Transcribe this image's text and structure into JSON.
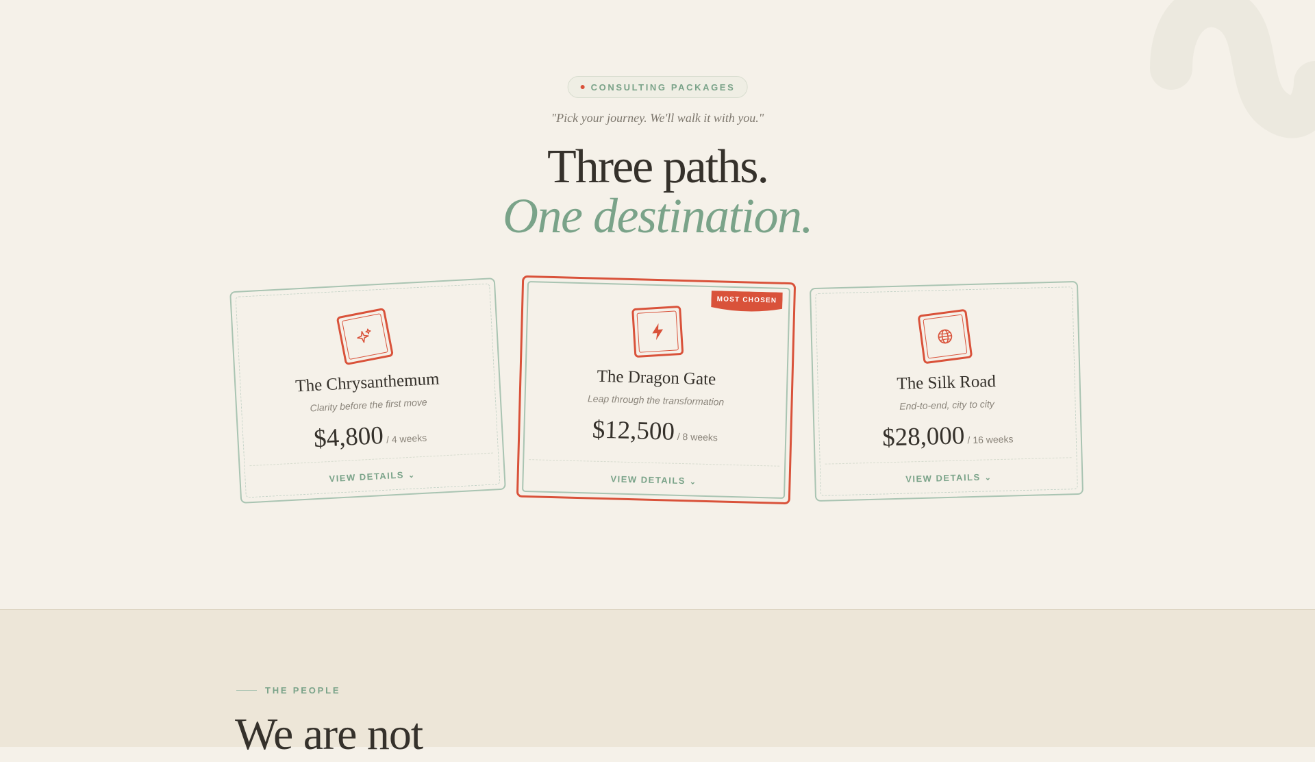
{
  "header": {
    "badge_label": "CONSULTING PACKAGES",
    "quote": "\"Pick your journey. We'll walk it with you.\"",
    "title_line1": "Three paths.",
    "title_line2": "One destination."
  },
  "packages": [
    {
      "icon": "sparkles-icon",
      "name": "The Chrysanthemum",
      "tagline": "Clarity before the first move",
      "price": "$4,800",
      "period": "/ 4 weeks",
      "details_label": "VIEW DETAILS"
    },
    {
      "icon": "lightning-icon",
      "name": "The Dragon Gate",
      "tagline": "Leap through the transformation",
      "price": "$12,500",
      "period": "/ 8 weeks",
      "details_label": "VIEW DETAILS",
      "ribbon": "MOST CHOSEN"
    },
    {
      "icon": "globe-icon",
      "name": "The Silk Road",
      "tagline": "End-to-end, city to city",
      "price": "$28,000",
      "period": "/ 16 weeks",
      "details_label": "VIEW DETAILS"
    }
  ],
  "people": {
    "label": "THE PEOPLE",
    "title": "We are not"
  },
  "colors": {
    "background": "#f5f1e9",
    "sage": "#7aa389",
    "accent_red": "#d9523a",
    "text_dark": "#35312b",
    "section_alt": "#ede6d8"
  }
}
